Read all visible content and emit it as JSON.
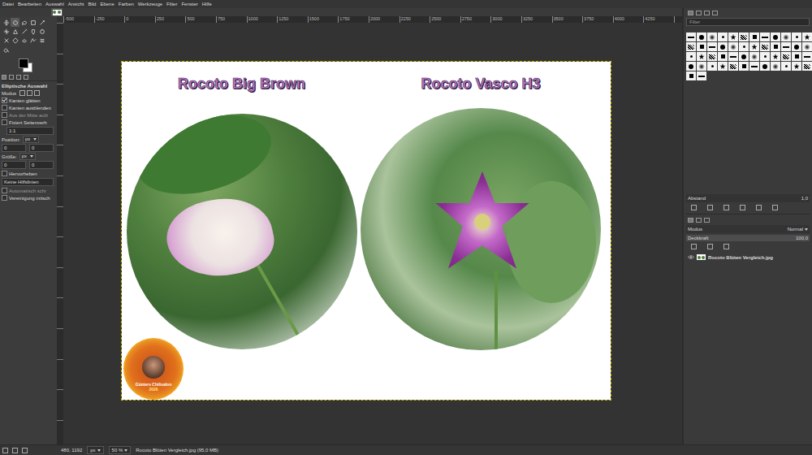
{
  "menu": [
    "Datei",
    "Bearbeiten",
    "Auswahl",
    "Ansicht",
    "Bild",
    "Ebene",
    "Farben",
    "Werkzeuge",
    "Filter",
    "Fenster",
    "Hilfe"
  ],
  "image_tabs": [
    {
      "selected": true
    }
  ],
  "tools": [
    {
      "selected": false
    },
    {
      "selected": true
    },
    {
      "selected": false
    },
    {
      "selected": false
    },
    {
      "selected": false
    },
    {
      "selected": false
    },
    {
      "selected": false
    },
    {
      "selected": false
    },
    {
      "selected": false
    },
    {
      "selected": false
    },
    {
      "selected": false
    },
    {
      "selected": false
    },
    {
      "selected": false
    },
    {
      "selected": false
    },
    {
      "selected": false
    },
    {
      "selected": false
    }
  ],
  "tool_options": {
    "title": "Elliptische Auswahl",
    "mode_label": "Modus",
    "rows": [
      {
        "kind": "check",
        "label": "Kanten glätten",
        "checked": true,
        "disabled": false
      },
      {
        "kind": "check",
        "label": "Kanten ausblenden",
        "checked": false,
        "disabled": false
      },
      {
        "kind": "check",
        "label": "Aus der Mitte aufz",
        "checked": false,
        "disabled": true
      },
      {
        "kind": "check",
        "label": "Fixiert Seitenverh",
        "checked": false,
        "disabled": false
      },
      {
        "kind": "field",
        "value": "1:1"
      },
      {
        "kind": "unit",
        "label": "Position:",
        "unit": "px"
      },
      {
        "kind": "pair",
        "values": [
          "0",
          "0"
        ]
      },
      {
        "kind": "unit",
        "label": "Größe:",
        "unit": "px"
      },
      {
        "kind": "pair",
        "values": [
          "0",
          "0"
        ]
      },
      {
        "kind": "check",
        "label": "Hervorheben",
        "checked": false,
        "disabled": false
      },
      {
        "kind": "dropdown",
        "value": "Keine Hilfslinien"
      },
      {
        "kind": "check",
        "label": "Automatisch schr",
        "checked": false,
        "disabled": true
      },
      {
        "kind": "check",
        "label": "Vereinigung mitsch",
        "checked": false,
        "disabled": false
      }
    ]
  },
  "rulers": {
    "top": [
      "-500",
      "-250",
      "0",
      "250",
      "500",
      "750",
      "1000",
      "1250",
      "1500",
      "1750",
      "2000",
      "2250",
      "2500",
      "2750",
      "3000",
      "3250",
      "3500",
      "3750",
      "4000",
      "4250"
    ]
  },
  "canvas": {
    "titles": [
      "Rocoto Big Brown",
      "Rocoto Vasco H3"
    ],
    "logo": {
      "name": "Günters Chilisalon",
      "year": "2026"
    }
  },
  "brushes_panel": {
    "filter_placeholder": "Filter",
    "spacing_label": "Abstand",
    "spacing_value": "1,0"
  },
  "layers_panel": {
    "mode_label": "Modus",
    "mode_value": "Normal",
    "opacity_label": "Deckkraft",
    "opacity_value": "100,0",
    "opacity_level": 1.0,
    "layers": [
      {
        "name": "Rocoto Blüten Vergleich.jpg",
        "visible": true,
        "selected": false
      }
    ]
  },
  "status_bar": {
    "coordinates": "480, 1192",
    "unit": "px",
    "zoom": "50 %",
    "file": "Rocoto Blüten Vergleich.jpg (95,0 MB)"
  }
}
